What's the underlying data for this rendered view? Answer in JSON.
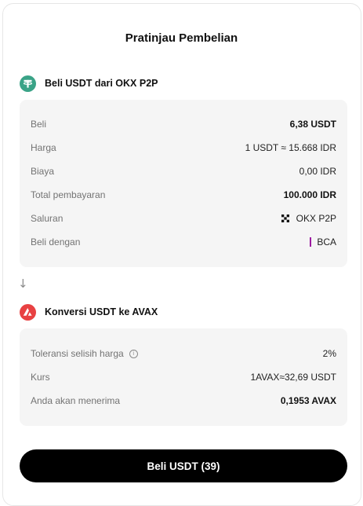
{
  "page": {
    "title": "Pratinjau Pembelian"
  },
  "section_buy": {
    "icon": "usdt-coin-icon",
    "icon_color": "#3aa387",
    "label": "Beli USDT dari OKX P2P",
    "rows": [
      {
        "key": "Beli",
        "value": "6,38 USDT"
      },
      {
        "key": "Harga",
        "value": "1 USDT ≈ 15.668 IDR"
      },
      {
        "key": "Biaya",
        "value": "0,00 IDR"
      },
      {
        "key": "Total pembayaran",
        "value": "100.000 IDR"
      },
      {
        "key": "Saluran",
        "value": "OKX P2P",
        "icon": "okx-logo-icon"
      },
      {
        "key": "Beli dengan",
        "value": "BCA",
        "icon": "bca-bar-icon",
        "icon_color": "#9c1aa0"
      }
    ]
  },
  "section_convert": {
    "icon": "avax-coin-icon",
    "icon_color": "#e84142",
    "label": "Konversi USDT ke AVAX",
    "rows": [
      {
        "key": "Toleransi selisih harga",
        "value": "2%",
        "icon": "info-icon"
      },
      {
        "key": "Kurs",
        "value": "1AVAX≈32,69 USDT"
      },
      {
        "key": "Anda akan menerima",
        "value": "0,1953 AVAX"
      }
    ]
  },
  "arrow_icon": "arrow-down-icon",
  "arrow_glyph": "↓",
  "info_glyph": "i",
  "buy_button": {
    "label": "Beli USDT (39)",
    "background": "#000000"
  }
}
